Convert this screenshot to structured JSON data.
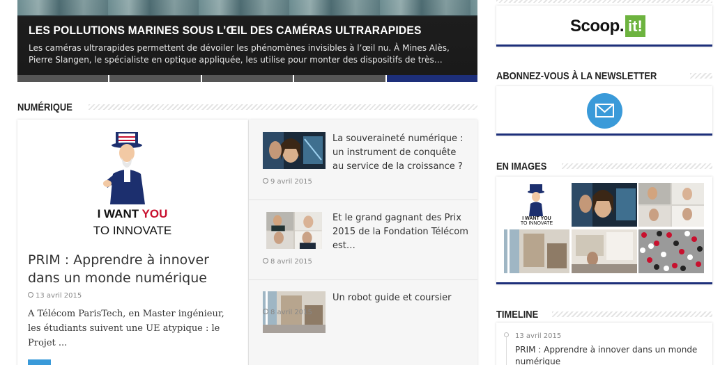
{
  "hero": {
    "title": "LES POLLUTIONS MARINES SOUS L’ŒIL DES CAMÉRAS ULTRARAPIDES",
    "description": "Les caméras ultrarapides permettent de dévoiler les phénomènes invisibles à l’œil nu. À Mines Alès, Pierre Slangen, le spécialiste en optique appliquée, les utilise pour monter des dispositifs de très…",
    "slides": 5,
    "active_slide": 5
  },
  "numerique": {
    "heading": "NUMÉRIQUE",
    "featured": {
      "image_text_1": "I WANT",
      "image_text_you": "YOU",
      "image_text_2": "TO INNOVATE",
      "title": "PRIM : Apprendre à innover dans un monde numérique",
      "date": "13 avril 2015",
      "excerpt": "A Télécom ParisTech, en Master ingénieur, les étudiants suivent une UE atypique : le Projet ..."
    },
    "items": [
      {
        "title": "La souveraineté numérique : un instrument de conquête au service de la croissance ?",
        "date": "9 avril 2015"
      },
      {
        "title": "Et le grand gagnant des Prix 2015 de la Fondation Télécom est…",
        "date": "8 avril 2015"
      },
      {
        "title": "Un robot guide et coursier",
        "date": "8 avril 2015"
      }
    ]
  },
  "sidebar": {
    "scoop_text": "Scoop.",
    "scoop_it": "it!",
    "newsletter_heading": "ABONNEZ-VOUS À LA NEWSLETTER",
    "images_heading": "EN IMAGES",
    "images_caption_1": "I WANT YOU",
    "images_caption_2": "TO INNOVATE",
    "timeline_heading": "TIMELINE",
    "timeline": [
      {
        "date": "13 avril 2015",
        "title": "PRIM : Apprendre à innover dans un monde numérique"
      }
    ]
  },
  "colors": {
    "accent": "#1d2f7a",
    "link_blue": "#3a9ad9",
    "scoop_green": "#6db33f",
    "you_red": "#c8102e"
  }
}
